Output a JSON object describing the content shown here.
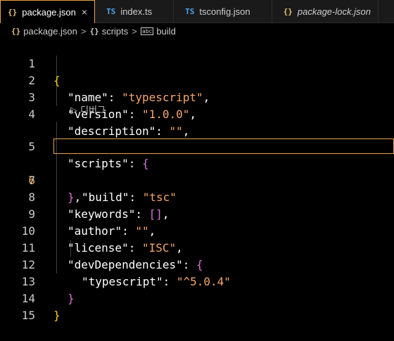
{
  "tabs": [
    {
      "icon": "{}",
      "label": "package.json",
      "active": true,
      "close": "×"
    },
    {
      "icon": "TS",
      "label": "index.ts"
    },
    {
      "icon": "TS",
      "label": "tsconfig.json"
    },
    {
      "icon": "{}",
      "label": "package-lock.json"
    }
  ],
  "breadcrumb": {
    "icon": "{}",
    "file": "package.json",
    "sep1": ">",
    "scripts_icon": "{}",
    "scripts": "scripts",
    "sep2": ">",
    "build_icon": "abc",
    "build": "build"
  },
  "codelens": "▷ 디버그",
  "lines": {
    "n1": "1",
    "n2": "2",
    "n3": "3",
    "n4": "4",
    "n5": "5",
    "n6": "6",
    "n7": "7",
    "n8": "8",
    "n9": "9",
    "n10": "10",
    "n11": "11",
    "n12": "12",
    "n13": "13",
    "n14": "14",
    "n15": "15"
  },
  "code": {
    "l1_brace": "{",
    "l2_key": "\"name\"",
    "l2_colon": ": ",
    "l2_val": "\"typescript\"",
    "l2_comma": ",",
    "l3_key": "\"version\"",
    "l3_colon": ": ",
    "l3_val": "\"1.0.0\"",
    "l3_comma": ",",
    "l4_key": "\"description\"",
    "l4_colon": ": ",
    "l4_val": "\"\"",
    "l4_comma": ",",
    "l5_key": "\"scripts\"",
    "l5_colon": ": ",
    "l5_brace": "{",
    "l6_key": "\"build\"",
    "l6_colon": ": ",
    "l6_val": "\"tsc\"",
    "l7_brace": "}",
    "l7_comma": ",",
    "l8_key": "\"keywords\"",
    "l8_colon": ": ",
    "l8_val": "[]",
    "l8_comma": ",",
    "l9_key": "\"author\"",
    "l9_colon": ": ",
    "l9_val": "\"\"",
    "l9_comma": ",",
    "l10_key": "\"license\"",
    "l10_colon": ": ",
    "l10_val": "\"ISC\"",
    "l10_comma": ",",
    "l11_key": "\"devDependencies\"",
    "l11_colon": ": ",
    "l11_brace": "{",
    "l12_key": "\"typescript\"",
    "l12_colon": ": ",
    "l12_val": "\"^5.0.4\"",
    "l13_brace": "}",
    "l14_brace": "}"
  },
  "colors": {
    "accent": "#e5a34a",
    "string": "#f5a66a",
    "bracket1": "#f8d417",
    "bracket2": "#d671d6",
    "bracket3": "#4a9cf5"
  }
}
